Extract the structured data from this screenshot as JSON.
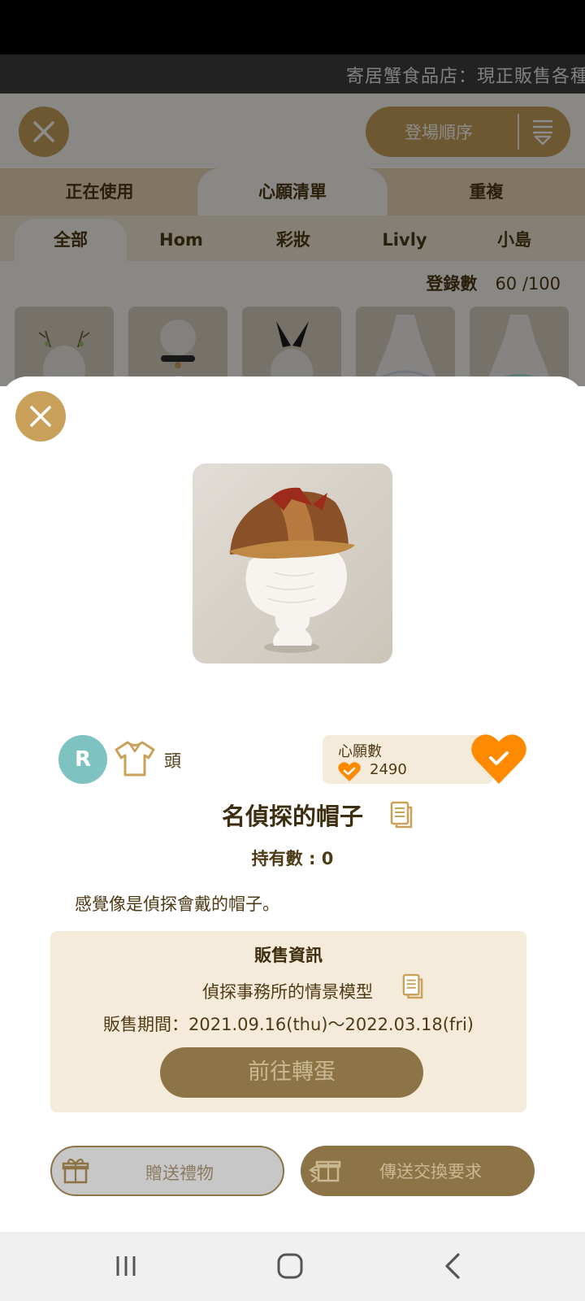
{
  "ticker": {
    "text": "寄居蟹食品店：現正販售各種"
  },
  "background_app": {
    "close_icon": "close-icon",
    "sort": {
      "label": "登場順序",
      "icon": "sort-icon"
    },
    "main_tabs": [
      {
        "label": "正在使用",
        "active": false
      },
      {
        "label": "心願清單",
        "active": true
      },
      {
        "label": "重複",
        "active": false
      }
    ],
    "sub_tabs": [
      {
        "label": "全部",
        "active": true
      },
      {
        "label": "Hom",
        "active": false
      },
      {
        "label": "彩妝",
        "active": false
      },
      {
        "label": "Livly",
        "active": false
      },
      {
        "label": "小島",
        "active": false
      }
    ],
    "registration": {
      "label": "登錄數",
      "value": "60 /100"
    }
  },
  "item_detail": {
    "rarity": "R",
    "category_icon": "shirt-icon",
    "category": "頭",
    "wishlist": {
      "label": "心願數",
      "count": "2490",
      "wished": true
    },
    "name": "名偵探的帽子",
    "owned": "持有數 : 0",
    "description": "感覺像是偵探會戴的帽子。",
    "sale_info": {
      "title": "販售資訊",
      "model": "偵探事務所的情景模型",
      "period": "販售期間：2021.09.16(thu)～2022.03.18(fri)",
      "gacha_button": "前往轉蛋"
    },
    "gift_button": "贈送禮物",
    "trade_button": "傳送交換要求"
  },
  "colors": {
    "accent_gold": "#c9a15b",
    "button_brown": "#8c7446",
    "heart_orange": "#ff8a00",
    "rarity_teal": "#7ec2c2",
    "panel_cream": "#f5ebdb"
  }
}
